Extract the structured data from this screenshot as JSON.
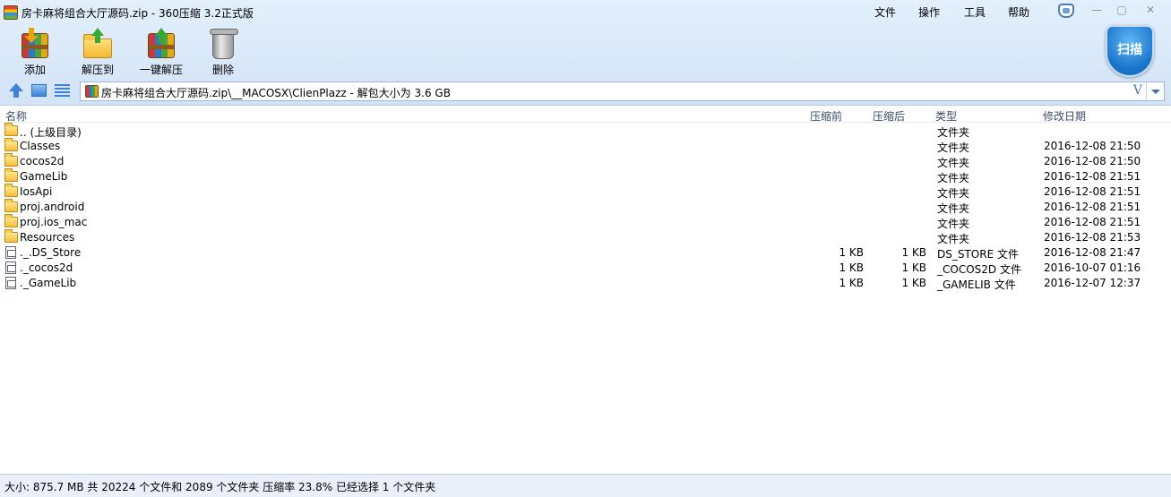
{
  "window": {
    "title": "房卡麻将组合大厅源码.zip - 360压缩 3.2正式版",
    "menu": [
      "文件",
      "操作",
      "工具",
      "帮助"
    ],
    "controls": [
      "—",
      "▢",
      "✕"
    ]
  },
  "toolbar": {
    "add_label": "添加",
    "extract_to_label": "解压到",
    "one_click_extract_label": "一键解压",
    "delete_label": "删除",
    "scan_label": "扫描"
  },
  "address": {
    "path": "房卡麻将组合大厅源码.zip\\__MACOSX\\ClienPlazz - 解包大小为 3.6 GB",
    "v_glyph": "V"
  },
  "columns": {
    "name": "名称",
    "compressed": "压缩前",
    "original": "压缩后",
    "type": "类型",
    "modified": "修改日期"
  },
  "rows": [
    {
      "icon": "folder",
      "name": ".. (上级目录)",
      "compressed": "",
      "original": "",
      "type": "文件夹",
      "date": ""
    },
    {
      "icon": "folder",
      "name": "Classes",
      "compressed": "",
      "original": "",
      "type": "文件夹",
      "date": "2016-12-08 21:50"
    },
    {
      "icon": "folder",
      "name": "cocos2d",
      "compressed": "",
      "original": "",
      "type": "文件夹",
      "date": "2016-12-08 21:50"
    },
    {
      "icon": "folder",
      "name": "GameLib",
      "compressed": "",
      "original": "",
      "type": "文件夹",
      "date": "2016-12-08 21:51"
    },
    {
      "icon": "folder",
      "name": "IosApi",
      "compressed": "",
      "original": "",
      "type": "文件夹",
      "date": "2016-12-08 21:51"
    },
    {
      "icon": "folder",
      "name": "proj.android",
      "compressed": "",
      "original": "",
      "type": "文件夹",
      "date": "2016-12-08 21:51"
    },
    {
      "icon": "folder",
      "name": "proj.ios_mac",
      "compressed": "",
      "original": "",
      "type": "文件夹",
      "date": "2016-12-08 21:51"
    },
    {
      "icon": "folder",
      "name": "Resources",
      "compressed": "",
      "original": "",
      "type": "文件夹",
      "date": "2016-12-08 21:53"
    },
    {
      "icon": "file",
      "name": "._.DS_Store",
      "compressed": "1 KB",
      "original": "1 KB",
      "type": "DS_STORE 文件",
      "date": "2016-12-08 21:47"
    },
    {
      "icon": "file",
      "name": "._cocos2d",
      "compressed": "1 KB",
      "original": "1 KB",
      "type": "_COCOS2D 文件",
      "date": "2016-10-07 01:16"
    },
    {
      "icon": "file",
      "name": "._GameLib",
      "compressed": "1 KB",
      "original": "1 KB",
      "type": "_GAMELIB 文件",
      "date": "2016-12-07 12:37"
    }
  ],
  "status": {
    "text": "大小: 875.7 MB 共 20224 个文件和 2089 个文件夹 压缩率 23.8% 已经选择 1 个文件夹"
  }
}
